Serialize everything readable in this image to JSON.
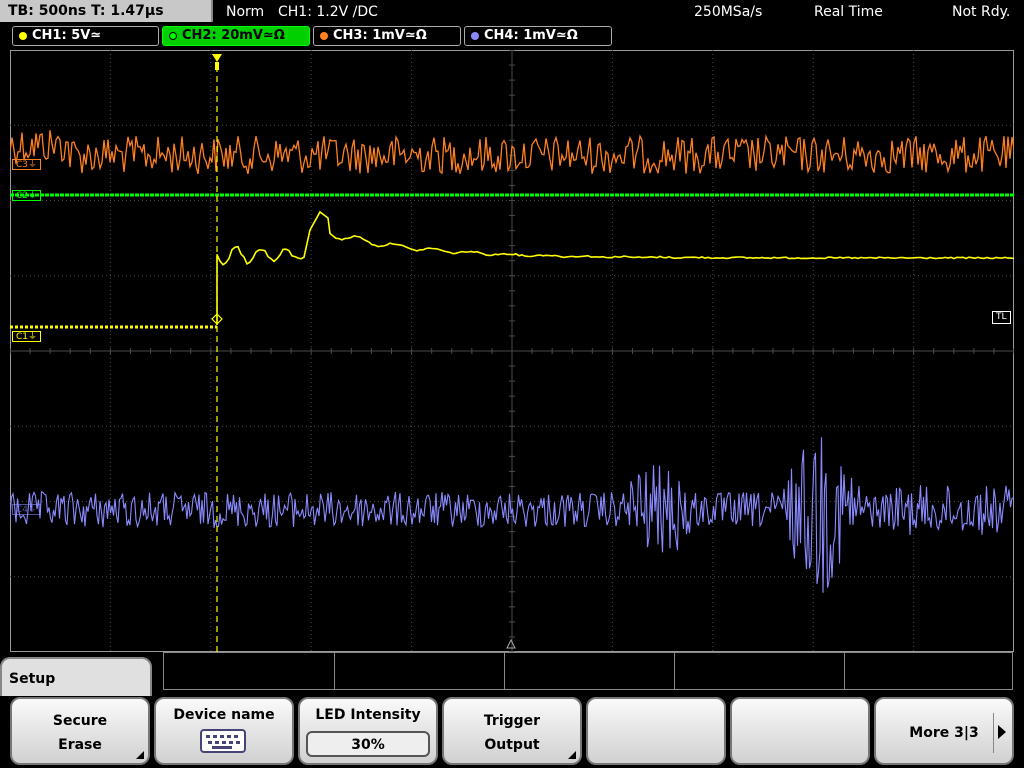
{
  "status": {
    "timebase": "TB: 500ns  T: 1.47µs",
    "mode": "Norm",
    "trigger": "CH1: 1.2V ∕DC",
    "sample_rate": "250MSa/s",
    "acq_mode": "Real Time",
    "state": "Not Rdy."
  },
  "channels": [
    {
      "label": "CH1: 5V≃",
      "color": "#ffff00",
      "active": false
    },
    {
      "label": "CH2: 20mV≃Ω",
      "color": "#00ff00",
      "active": true
    },
    {
      "label": "CH3: 1mV≃Ω",
      "color": "#ff8020",
      "active": false
    },
    {
      "label": "CH4: 1mV≃Ω",
      "color": "#8a8aff",
      "active": false
    }
  ],
  "markers": {
    "c3": "C3⏚",
    "c2": "C2⏚",
    "c1": "C1⏚",
    "c4": "C4⏚",
    "tl": "TL"
  },
  "menu": {
    "title": "Setup",
    "softkeys": [
      {
        "line1": "Secure",
        "line2": "Erase",
        "has_submenu": true
      },
      {
        "line1": "Device name",
        "icon": "keyboard-icon"
      },
      {
        "line1": "LED Intensity",
        "value": "30%"
      },
      {
        "line1": "Trigger",
        "line2": "Output",
        "has_submenu": true
      },
      {
        "line1": ""
      },
      {
        "line1": ""
      },
      {
        "line1": "More 3|3",
        "icon": "next-arrow-icon"
      }
    ]
  },
  "colors": {
    "grid": "#505050",
    "ch1": "#ffff00",
    "ch2": "#00ff00",
    "ch3": "#ff8020",
    "ch4": "#8a8aff",
    "trigger_marker": "#ffff00"
  }
}
